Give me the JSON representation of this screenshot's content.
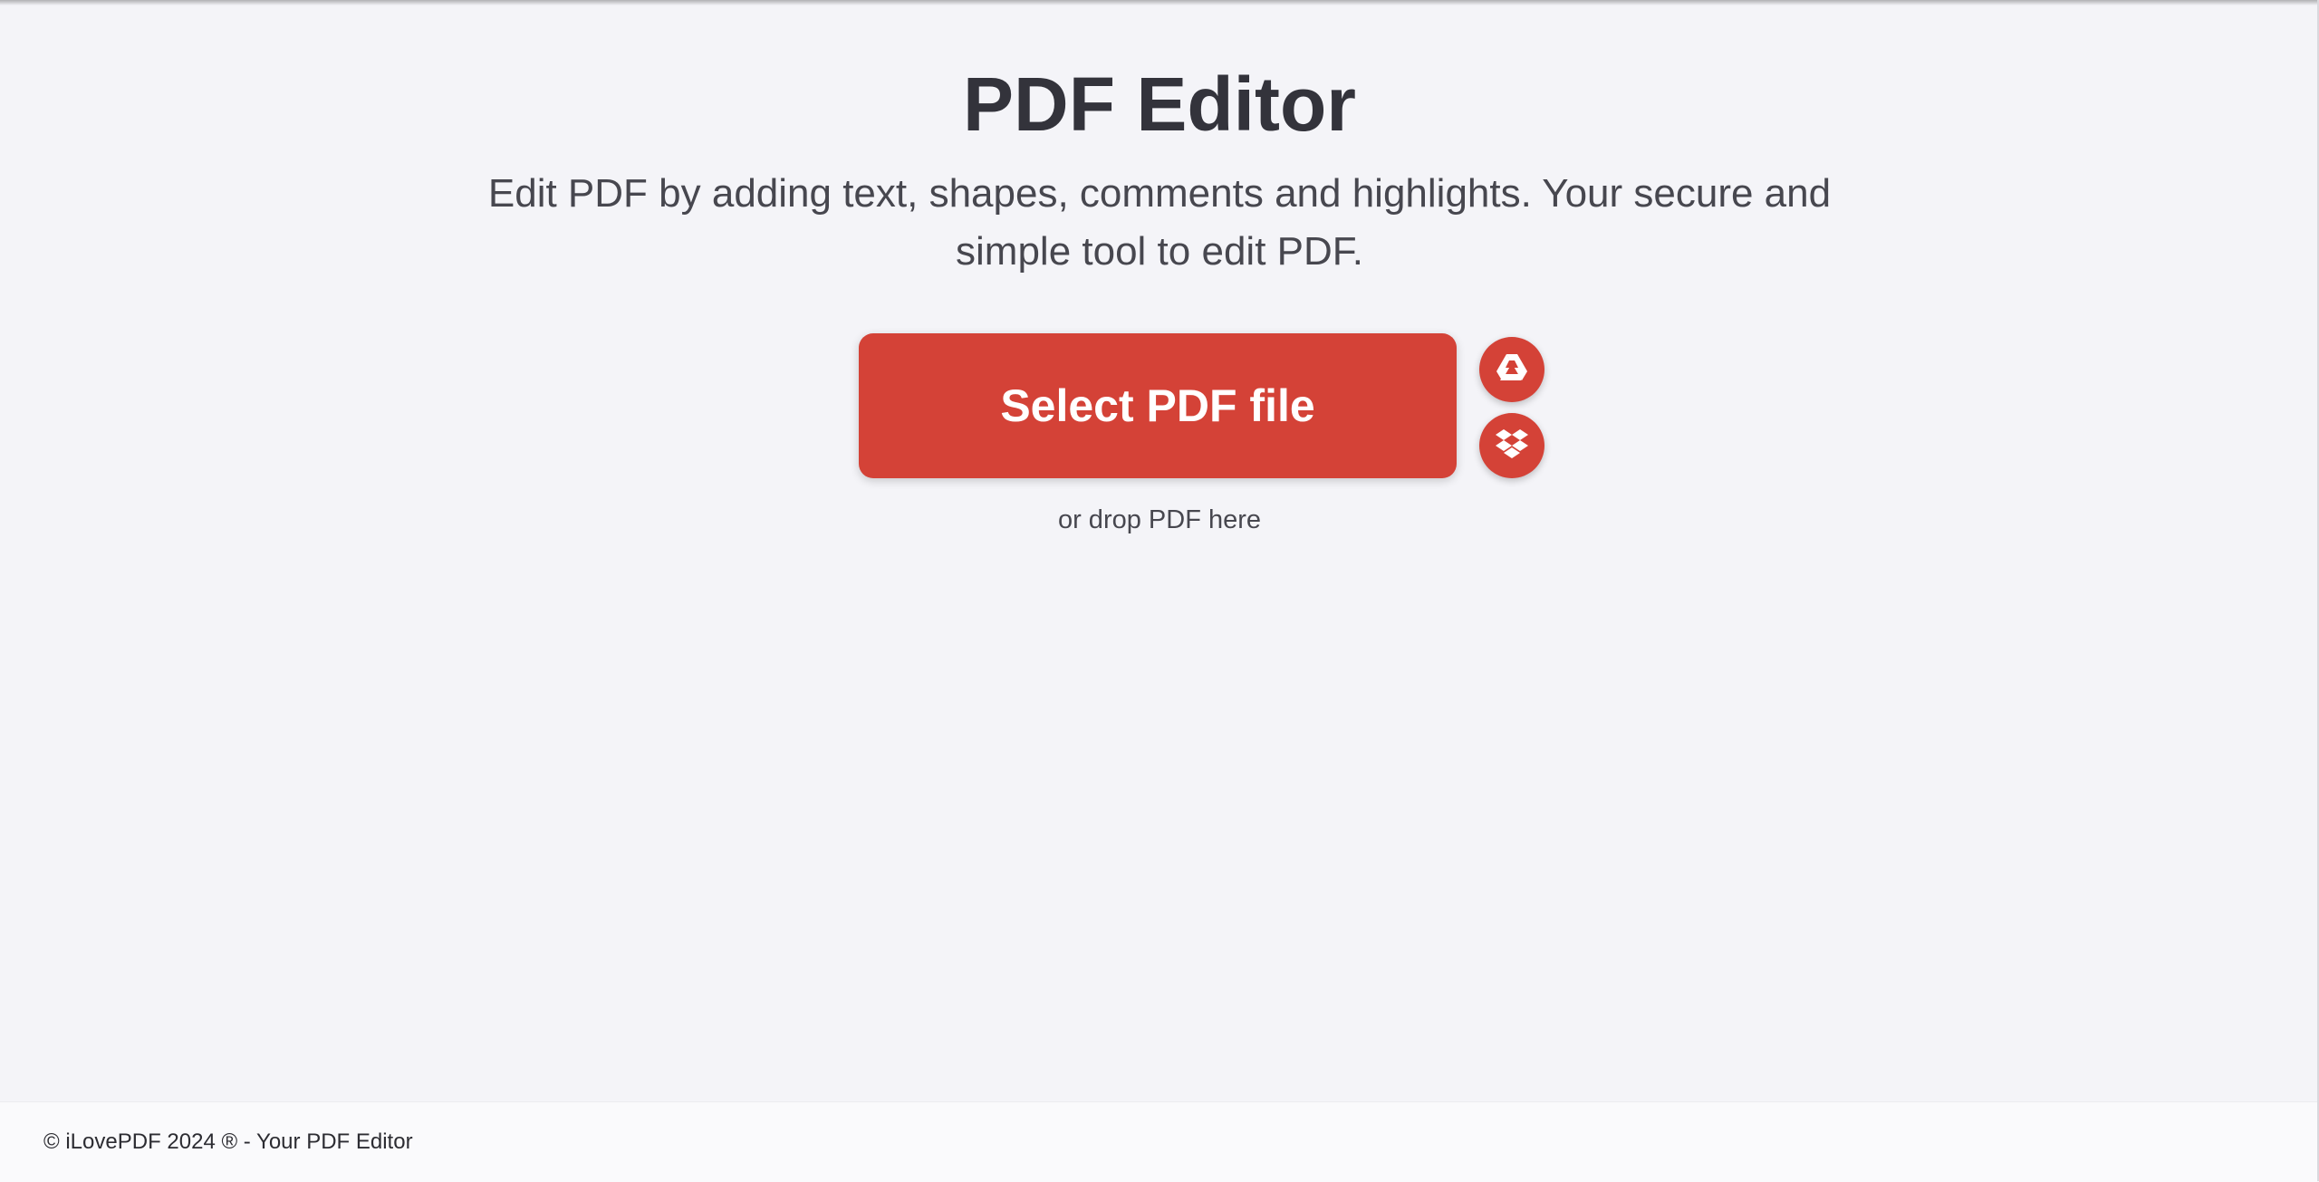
{
  "header": {
    "title": "PDF Editor",
    "subtitle": "Edit PDF by adding text, shapes, comments and highlights. Your secure and simple tool to edit PDF."
  },
  "upload": {
    "select_label": "Select PDF file",
    "drop_hint": "or drop PDF here",
    "cloud_sources": [
      {
        "name": "google-drive-icon"
      },
      {
        "name": "dropbox-icon"
      }
    ]
  },
  "footer": {
    "text": "© iLovePDF 2024 ® - Your PDF Editor"
  },
  "colors": {
    "accent": "#d44237",
    "background": "#f4f4f8",
    "text": "#33333b"
  }
}
